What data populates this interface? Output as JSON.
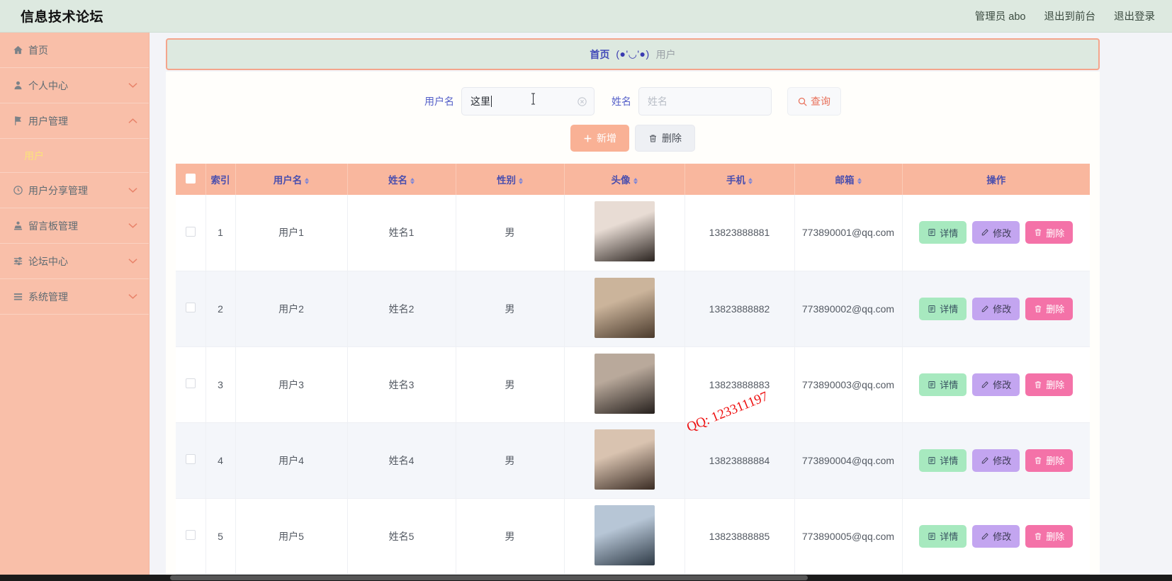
{
  "header": {
    "brand": "信息技术论坛",
    "links": [
      {
        "label": "管理员 abo",
        "name": "admin-user"
      },
      {
        "label": "退出到前台",
        "name": "exit-to-front"
      },
      {
        "label": "退出登录",
        "name": "logout"
      }
    ]
  },
  "sidebar": {
    "items": [
      {
        "label": "首页",
        "icon": "home-icon",
        "arrow": ""
      },
      {
        "label": "个人中心",
        "icon": "user-icon",
        "arrow": "down"
      },
      {
        "label": "用户管理",
        "icon": "flag-icon",
        "arrow": "up"
      },
      {
        "label": "用户分享管理",
        "icon": "clock-icon",
        "arrow": "down"
      },
      {
        "label": "留言板管理",
        "icon": "stamp-icon",
        "arrow": "down"
      },
      {
        "label": "论坛中心",
        "icon": "sliders-icon",
        "arrow": "down"
      },
      {
        "label": "系统管理",
        "icon": "list-icon",
        "arrow": "down"
      }
    ],
    "sub_item": "用户"
  },
  "breadcrumb": {
    "home": "首页",
    "separator": "(●'◡'●)",
    "current": "用户"
  },
  "search": {
    "username_label": "用户名",
    "username_value": "这里",
    "name_label": "姓名",
    "name_placeholder": "姓名",
    "query_label": "查询"
  },
  "actions": {
    "add_label": "新增",
    "delete_label": "删除"
  },
  "table": {
    "columns": [
      {
        "label": "",
        "name": "select-all",
        "sortable": false
      },
      {
        "label": "索引",
        "name": "index",
        "sortable": false
      },
      {
        "label": "用户名",
        "name": "username",
        "sortable": true
      },
      {
        "label": "姓名",
        "name": "name",
        "sortable": true
      },
      {
        "label": "性别",
        "name": "gender",
        "sortable": true
      },
      {
        "label": "头像",
        "name": "avatar",
        "sortable": true
      },
      {
        "label": "手机",
        "name": "phone",
        "sortable": true
      },
      {
        "label": "邮箱",
        "name": "email",
        "sortable": true
      },
      {
        "label": "操作",
        "name": "operations",
        "sortable": false
      }
    ],
    "row_buttons": {
      "detail": "详情",
      "edit": "修改",
      "delete": "删除"
    },
    "rows": [
      {
        "index": "1",
        "username": "用户1",
        "name": "姓名1",
        "gender": "男",
        "phone": "13823888881",
        "email": "773890001@qq.com",
        "avatar_colors": [
          "#e8dcd4",
          "#2b2420"
        ]
      },
      {
        "index": "2",
        "username": "用户2",
        "name": "姓名2",
        "gender": "男",
        "phone": "13823888882",
        "email": "773890002@qq.com",
        "avatar_colors": [
          "#cbb49b",
          "#4a3a2c"
        ]
      },
      {
        "index": "3",
        "username": "用户3",
        "name": "姓名3",
        "gender": "男",
        "phone": "13823888883",
        "email": "773890003@qq.com",
        "avatar_colors": [
          "#b9a99b",
          "#26201d"
        ]
      },
      {
        "index": "4",
        "username": "用户4",
        "name": "姓名4",
        "gender": "男",
        "phone": "13823888884",
        "email": "773890004@qq.com",
        "avatar_colors": [
          "#d9c3b0",
          "#3a2c24"
        ]
      },
      {
        "index": "5",
        "username": "用户5",
        "name": "姓名5",
        "gender": "男",
        "phone": "13823888885",
        "email": "773890005@qq.com",
        "avatar_colors": [
          "#b7c6d6",
          "#2e3a46"
        ]
      }
    ]
  },
  "watermark": "QQ: 123311197",
  "colors": {
    "sidebar_bg": "#f9bfa9",
    "header_bg": "#dde9e0",
    "accent": "#f4a58c",
    "table_header_bg": "#f9b79e",
    "table_header_text": "#4b4fae",
    "link_blue": "#4048b8",
    "sub_item_yellow": "#fbe27a",
    "watermark_red": "#ee1111"
  }
}
